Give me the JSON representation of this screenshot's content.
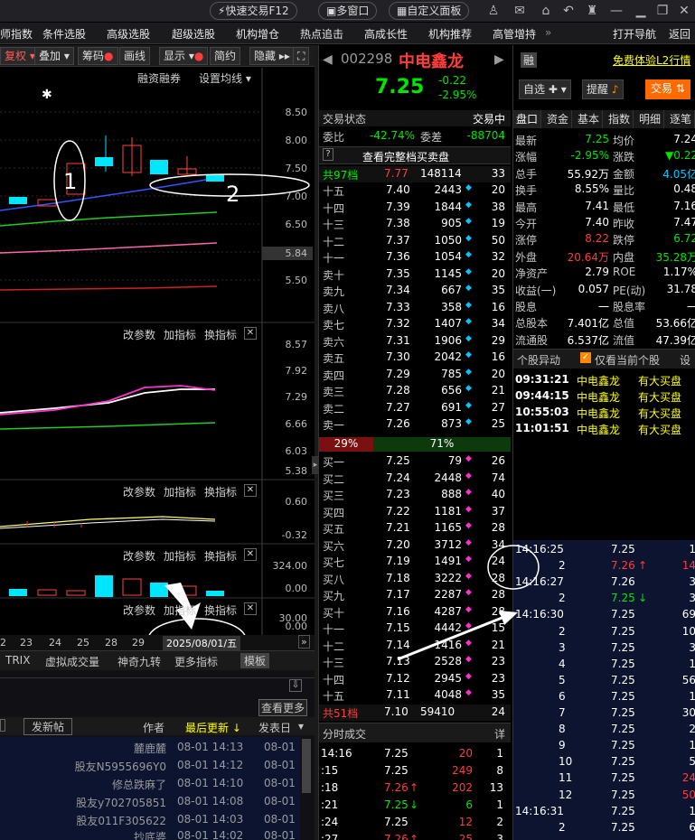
{
  "topbar": {
    "quick_trade": "快速交易F12",
    "multi_window": "多窗口",
    "custom_panel": "自定义面板"
  },
  "nav": [
    "师指数",
    "条件选股",
    "高级选股",
    "超级选股",
    "机构增仓",
    "热点追击",
    "高成长性",
    "机构推荐",
    "高管增持"
  ],
  "nav_right": [
    "打开导航",
    "返回"
  ],
  "chart_toolbar": [
    "复权",
    "叠加",
    "筹码",
    "画线",
    "显示",
    "简约",
    "隐藏"
  ],
  "chart_labels": {
    "margin": "融资融券",
    "ma_setting": "设置均线",
    "price_axis": [
      "8.50",
      "8.00",
      "7.50",
      "7.00",
      "6.50",
      "6.00",
      "5.84",
      "5.50"
    ],
    "panel2_axis": [
      "8.57",
      "7.92",
      "7.29",
      "6.66",
      "6.03",
      "5.38"
    ],
    "panel3_axis": [
      "0.60",
      "-0.32"
    ],
    "panel4_axis": [
      "324.00",
      "0.00"
    ],
    "panel5_axis": [
      "30.00",
      "0.00"
    ],
    "panel_btns": [
      "改参数",
      "加指标",
      "换指标"
    ],
    "dates": [
      "2",
      "23",
      "24",
      "25",
      "28",
      "29"
    ],
    "date_box": "2025/08/01/五",
    "bottom_tabs": [
      "TRIX",
      "虚拟成交量",
      "神奇九转",
      "更多指标",
      "模板"
    ],
    "annotation_1": "1",
    "annotation_2": "2"
  },
  "posts": {
    "view_more": "查看更多",
    "new_post": "发新帖",
    "author": "作者",
    "last_update": "最后更新",
    "post_date": "发表日",
    "rows": [
      {
        "author": "麓鹿麓",
        "update": "08-01 14:13",
        "date": "08-01"
      },
      {
        "author": "股友N5955696Y0",
        "update": "08-01 14:12",
        "date": "08-01"
      },
      {
        "author": "修总跌麻了",
        "update": "08-01 14:10",
        "date": "08-01"
      },
      {
        "author": "股友y702705851",
        "update": "08-01 14:08",
        "date": "08-01"
      },
      {
        "author": "股友011F305622",
        "update": "08-01 14:03",
        "date": "08-01"
      },
      {
        "author": "抄底婆",
        "update": "08-01 14:02",
        "date": "08-01"
      }
    ]
  },
  "stock": {
    "code": "002298",
    "name": "中电鑫龙",
    "price": "7.25",
    "change": "-0.22",
    "change_pct": "-2.95%",
    "badge": "融"
  },
  "trade_status": {
    "label": "交易状态",
    "value": "交易中",
    "ratio_label": "委比",
    "ratio": "-42.74%",
    "diff_label": "委差",
    "diff": "-88704",
    "view_all": "查看完整档买卖盘",
    "asks_total_label": "共97档",
    "asks_total_price": "7.77",
    "asks_total_vol": "148114",
    "asks_total_cnt": "33",
    "bids_total_label": "共51档",
    "bids_total_price": "7.10",
    "bids_total_vol": "59410",
    "bids_total_cnt": "24",
    "bar_left": "29%",
    "bar_right": "71%"
  },
  "asks": [
    {
      "lvl": "十五",
      "p": "7.40",
      "v": "2443",
      "c": "20"
    },
    {
      "lvl": "十四",
      "p": "7.39",
      "v": "1844",
      "c": "38"
    },
    {
      "lvl": "十三",
      "p": "7.38",
      "v": "905",
      "c": "19"
    },
    {
      "lvl": "十二",
      "p": "7.37",
      "v": "1050",
      "c": "50"
    },
    {
      "lvl": "十一",
      "p": "7.36",
      "v": "1054",
      "c": "32"
    },
    {
      "lvl": "卖十",
      "p": "7.35",
      "v": "1145",
      "c": "20"
    },
    {
      "lvl": "卖九",
      "p": "7.34",
      "v": "667",
      "c": "35"
    },
    {
      "lvl": "卖八",
      "p": "7.33",
      "v": "358",
      "c": "16"
    },
    {
      "lvl": "卖七",
      "p": "7.32",
      "v": "1407",
      "c": "34"
    },
    {
      "lvl": "卖六",
      "p": "7.31",
      "v": "1906",
      "c": "29"
    },
    {
      "lvl": "卖五",
      "p": "7.30",
      "v": "2042",
      "c": "16"
    },
    {
      "lvl": "卖四",
      "p": "7.29",
      "v": "785",
      "c": "20"
    },
    {
      "lvl": "卖三",
      "p": "7.28",
      "v": "656",
      "c": "21"
    },
    {
      "lvl": "卖二",
      "p": "7.27",
      "v": "691",
      "c": "27"
    },
    {
      "lvl": "卖一",
      "p": "7.26",
      "v": "873",
      "c": "25"
    }
  ],
  "bids": [
    {
      "lvl": "买一",
      "p": "7.25",
      "v": "79",
      "c": "26"
    },
    {
      "lvl": "买二",
      "p": "7.24",
      "v": "2448",
      "c": "74"
    },
    {
      "lvl": "买三",
      "p": "7.23",
      "v": "888",
      "c": "40"
    },
    {
      "lvl": "买四",
      "p": "7.22",
      "v": "1181",
      "c": "37"
    },
    {
      "lvl": "买五",
      "p": "7.21",
      "v": "1165",
      "c": "28"
    },
    {
      "lvl": "买六",
      "p": "7.20",
      "v": "3712",
      "c": "34"
    },
    {
      "lvl": "买七",
      "p": "7.19",
      "v": "1491",
      "c": "24"
    },
    {
      "lvl": "买八",
      "p": "7.18",
      "v": "3222",
      "c": "28"
    },
    {
      "lvl": "买九",
      "p": "7.17",
      "v": "2287",
      "c": "28"
    },
    {
      "lvl": "买十",
      "p": "7.16",
      "v": "4287",
      "c": "28"
    },
    {
      "lvl": "十一",
      "p": "7.15",
      "v": "4442",
      "c": "15"
    },
    {
      "lvl": "十二",
      "p": "7.14",
      "v": "1416",
      "c": "21"
    },
    {
      "lvl": "十三",
      "p": "7.13",
      "v": "2528",
      "c": "23"
    },
    {
      "lvl": "十四",
      "p": "7.12",
      "v": "2945",
      "c": "23"
    },
    {
      "lvl": "十五",
      "p": "7.11",
      "v": "4048",
      "c": "35"
    }
  ],
  "time_sales": {
    "title": "分时成交",
    "detail": "详",
    "rows": [
      {
        "t": "14:16",
        "p": "7.25",
        "arrow": "",
        "v": "20",
        "n": "1"
      },
      {
        "t": ":15",
        "p": "7.25",
        "arrow": "",
        "v": "249",
        "n": "8"
      },
      {
        "t": ":18",
        "p": "7.26",
        "arrow": "↑",
        "v": "202",
        "n": "13"
      },
      {
        "t": ":21",
        "p": "7.25",
        "arrow": "↓",
        "v": "6",
        "n": "1"
      },
      {
        "t": ":24",
        "p": "7.25",
        "arrow": "",
        "v": "12",
        "n": "2"
      },
      {
        "t": ":27",
        "p": "7.26",
        "arrow": "↑",
        "v": "25",
        "n": "3"
      }
    ]
  },
  "right": {
    "free_l2": "免费体验L2行情",
    "watch": "自选",
    "remind": "提醒",
    "trade": "交易",
    "tabs": [
      "盘口",
      "资金",
      "基本",
      "指数",
      "明细",
      "逐笔"
    ],
    "quote": [
      {
        "k1": "最新",
        "v1": "7.25",
        "k2": "均价",
        "v2": "7.24"
      },
      {
        "k1": "涨幅",
        "v1": "-2.95%",
        "k2": "涨跌",
        "v2": "▼0.22"
      },
      {
        "k1": "总手",
        "v1": "55.92万",
        "k2": "金额",
        "v2": "4.05亿"
      },
      {
        "k1": "换手",
        "v1": "8.55%",
        "k2": "量比",
        "v2": "0.48"
      },
      {
        "k1": "最高",
        "v1": "7.41",
        "k2": "最低",
        "v2": "7.16"
      },
      {
        "k1": "今开",
        "v1": "7.40",
        "k2": "昨收",
        "v2": "7.47"
      },
      {
        "k1": "涨停",
        "v1": "8.22",
        "k2": "跌停",
        "v2": "6.72"
      },
      {
        "k1": "外盘",
        "v1": "20.64万",
        "k2": "内盘",
        "v2": "35.28万"
      },
      {
        "k1": "净资产",
        "v1": "2.79",
        "k2": "ROE",
        "v2": "1.17%"
      },
      {
        "k1": "收益(一)",
        "v1": "0.057",
        "k2": "PE(动)",
        "v2": "31.78"
      },
      {
        "k1": "股息",
        "v1": "一",
        "k2": "股息率",
        "v2": "一"
      },
      {
        "k1": "总股本",
        "v1": "7.401亿",
        "k2": "总值",
        "v2": "53.66亿"
      },
      {
        "k1": "流通股",
        "v1": "6.537亿",
        "k2": "流值",
        "v2": "47.39亿"
      }
    ],
    "movement_title": "个股异动",
    "only_current": "仅看当前个股",
    "movement_setting": "设",
    "movements": [
      {
        "t": "09:31:21",
        "name": "中电鑫龙",
        "event": "有大买盘"
      },
      {
        "t": "09:44:15",
        "name": "中电鑫龙",
        "event": "有大买盘"
      },
      {
        "t": "10:55:03",
        "name": "中电鑫龙",
        "event": "有大买盘"
      },
      {
        "t": "11:01:51",
        "name": "中电鑫龙",
        "event": "有大买盘"
      }
    ],
    "ticks": [
      {
        "t": "14:16:25",
        "p": "7.25",
        "a": "",
        "v": "1"
      },
      {
        "t": "2",
        "p": "7.26",
        "a": "↑",
        "v": "14"
      },
      {
        "t": "14:16:27",
        "p": "7.26",
        "a": "",
        "v": "3"
      },
      {
        "t": "2",
        "p": "7.25",
        "a": "↓",
        "v": "3"
      },
      {
        "t": "14:16:30",
        "p": "7.25",
        "a": "",
        "v": "69"
      },
      {
        "t": "2",
        "p": "7.25",
        "a": "",
        "v": "10"
      },
      {
        "t": "3",
        "p": "7.25",
        "a": "",
        "v": "3"
      },
      {
        "t": "4",
        "p": "7.25",
        "a": "",
        "v": "1"
      },
      {
        "t": "5",
        "p": "7.25",
        "a": "",
        "v": "56"
      },
      {
        "t": "6",
        "p": "7.25",
        "a": "",
        "v": "1"
      },
      {
        "t": "7",
        "p": "7.25",
        "a": "",
        "v": "30"
      },
      {
        "t": "8",
        "p": "7.25",
        "a": "",
        "v": "2"
      },
      {
        "t": "9",
        "p": "7.25",
        "a": "",
        "v": "1"
      },
      {
        "t": "10",
        "p": "7.25",
        "a": "",
        "v": "5"
      },
      {
        "t": "11",
        "p": "7.25",
        "a": "",
        "v": "24"
      },
      {
        "t": "12",
        "p": "7.25",
        "a": "",
        "v": "50"
      },
      {
        "t": "14:16:31",
        "p": "7.25",
        "a": "",
        "v": "1"
      },
      {
        "t": "2",
        "p": "7.25",
        "a": "",
        "v": "6"
      }
    ]
  }
}
